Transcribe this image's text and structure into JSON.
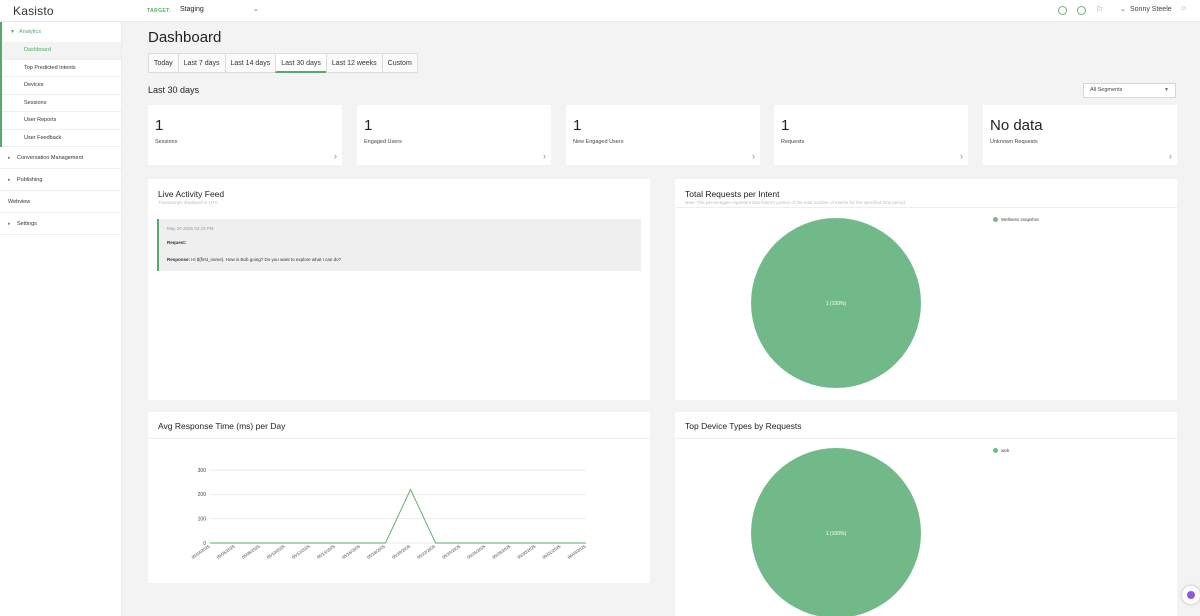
{
  "app": {
    "logo": "Kasisto"
  },
  "topbar": {
    "target_label": "TARGET:",
    "target_value": "Staging",
    "user_name": "Sonny Steele"
  },
  "sidebar": {
    "analytics": {
      "label": "Analytics",
      "items": [
        {
          "label": "Dashboard",
          "active": true
        },
        {
          "label": "Top Predicted Intents"
        },
        {
          "label": "Devices"
        },
        {
          "label": "Sessions"
        },
        {
          "label": "User Reports"
        },
        {
          "label": "User Feedback"
        }
      ]
    },
    "others": [
      {
        "label": "Conversation Management",
        "caret": true
      },
      {
        "label": "Publishing",
        "caret": true
      },
      {
        "label": "Webview",
        "caret": false
      },
      {
        "label": "Settings",
        "caret": true
      }
    ]
  },
  "main": {
    "title": "Dashboard",
    "tabs": [
      {
        "label": "Today"
      },
      {
        "label": "Last 7 days"
      },
      {
        "label": "Last 14 days"
      },
      {
        "label": "Last 30 days",
        "active": true
      },
      {
        "label": "Last 12 weeks"
      },
      {
        "label": "Custom"
      }
    ],
    "range_heading": "Last 30 days",
    "segment_select": "All Segments",
    "stats": [
      {
        "value": "1",
        "label": "Sessions"
      },
      {
        "value": "1",
        "label": "Engaged Users"
      },
      {
        "value": "1",
        "label": "New Engaged Users"
      },
      {
        "value": "1",
        "label": "Requests"
      },
      {
        "value": "No data",
        "label": "Unknown Requests"
      }
    ],
    "live_feed": {
      "title": "Live Activity Feed",
      "note": "Timestamps displayed in UTC",
      "items": [
        {
          "time": "May 20 2025 02:43 PM",
          "request_label": "Request:",
          "response_label": "Response:",
          "response_text": " Hi ${first_name}. How is Bob going? Do you want to explore what I can do?"
        }
      ]
    },
    "intent_panel": {
      "title": "Total Requests per Intent",
      "note": "Note: The percentages represent that intent's portion of the total number of intents for the specified time period."
    },
    "response_panel": {
      "title": "Avg Response Time (ms) per Day"
    },
    "device_panel": {
      "title": "Top Device Types by Requests"
    }
  },
  "colors": {
    "accent": "#58a86b",
    "pie": "#72b98a",
    "bg": "#f3f3f3"
  },
  "chart_data": [
    {
      "type": "pie",
      "slices": [
        {
          "label": "Wellness snapshot",
          "value": 1,
          "text": "1 (100%)"
        }
      ]
    },
    {
      "type": "line",
      "title": "Avg Response Time (ms) per Day",
      "x": [
        "05/04/2025",
        "05/06/2025",
        "05/08/2025",
        "05/10/2025",
        "05/12/2025",
        "05/14/2025",
        "05/16/2025",
        "05/18/2025",
        "05/20/2025",
        "05/22/2025",
        "05/24/2025",
        "05/26/2025",
        "05/28/2025",
        "05/30/2025",
        "06/01/2025",
        "06/03/2025"
      ],
      "series": [
        {
          "values": [
            0,
            0,
            0,
            0,
            0,
            0,
            0,
            0,
            220,
            0,
            0,
            0,
            0,
            0,
            0,
            0
          ]
        }
      ],
      "yticks": [
        0,
        100,
        200,
        300
      ],
      "ylim": [
        0,
        300
      ]
    },
    {
      "type": "pie",
      "slices": [
        {
          "label": "web",
          "value": 1,
          "text": "1 (100%)"
        }
      ]
    }
  ]
}
